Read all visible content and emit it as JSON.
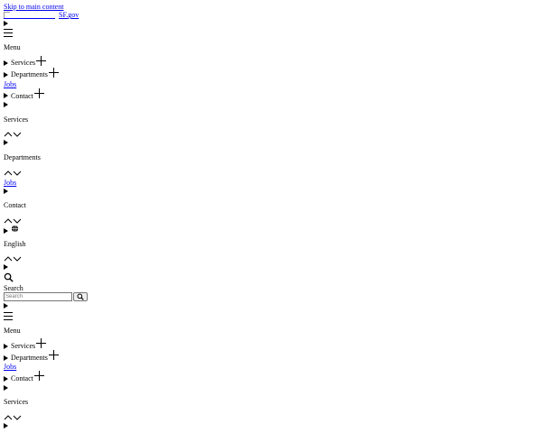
{
  "skip_link": "Skip to main content",
  "logo_text": "SF.gov",
  "menu_label": "Menu",
  "nav_items": {
    "services": "Services",
    "departments": "Departments",
    "jobs": "Jobs",
    "contact": "Contact"
  },
  "sections": {
    "services": "Services",
    "departments": "Departments",
    "jobs": "Jobs",
    "contact": "Contact"
  },
  "language": "English",
  "search": {
    "label": "Search",
    "placeholder": "Search"
  },
  "icons": {
    "menu": "hamburger-icon",
    "plus": "plus-icon",
    "globe": "globe-icon",
    "search": "magnifier-icon",
    "chevrons": "chevron-up-down-icon"
  }
}
